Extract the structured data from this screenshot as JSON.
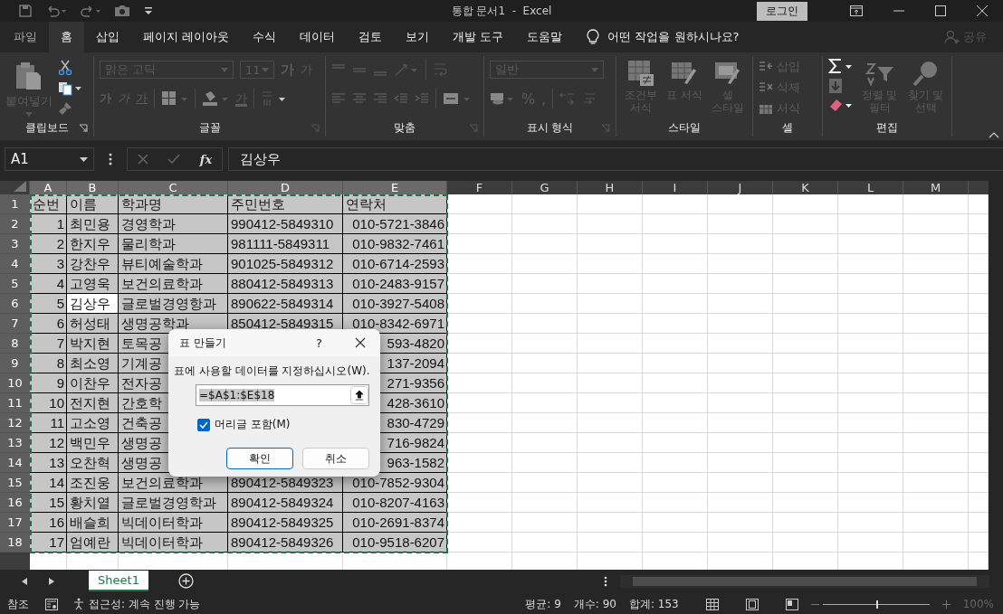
{
  "title_bar": {
    "title": "통합 문서1  -  Excel",
    "login": "로그인"
  },
  "tabs": [
    {
      "label": "파일",
      "selected": false
    },
    {
      "label": "홈",
      "selected": true
    },
    {
      "label": "삽입",
      "selected": false
    },
    {
      "label": "페이지 레이아웃",
      "selected": false
    },
    {
      "label": "수식",
      "selected": false
    },
    {
      "label": "데이터",
      "selected": false
    },
    {
      "label": "검토",
      "selected": false
    },
    {
      "label": "보기",
      "selected": false
    },
    {
      "label": "개발 도구",
      "selected": false
    },
    {
      "label": "도움말",
      "selected": false
    }
  ],
  "tell_me": "어떤 작업을 원하시나요?",
  "share": "공유",
  "ribbon": {
    "clipboard": {
      "paste": "붙여넣기",
      "label": "클립보드"
    },
    "font": {
      "name": "맑은 고딕",
      "size": "11",
      "grow": "가",
      "shrink": "가",
      "bold": "가",
      "italic": "가",
      "underline": "가",
      "font_color_label": "가",
      "label": "글꼴"
    },
    "alignment": {
      "label": "맞춤"
    },
    "number": {
      "format": "일반",
      "percent": "%",
      "comma": ",",
      "label": "표시 형식"
    },
    "styles": {
      "conditional": "조건부 서식",
      "table": "표 서식",
      "cell": "셀 스타일",
      "label": "스타일"
    },
    "cells": {
      "insert": "삽입",
      "delete": "삭제",
      "format": "서식",
      "label": "셀"
    },
    "editing": {
      "sort": "정렬 및 필터",
      "find": "찾기 및 선택",
      "label": "편집"
    }
  },
  "formula_bar": {
    "name_box": "A1",
    "fx": "fx",
    "value": "김상우"
  },
  "sheet": {
    "columns": [
      {
        "label": "A",
        "selected": true
      },
      {
        "label": "B",
        "selected": true
      },
      {
        "label": "C",
        "selected": true
      },
      {
        "label": "D",
        "selected": true
      },
      {
        "label": "E",
        "selected": true
      },
      {
        "label": "F",
        "selected": false
      },
      {
        "label": "G",
        "selected": false
      },
      {
        "label": "H",
        "selected": false
      },
      {
        "label": "I",
        "selected": false
      },
      {
        "label": "J",
        "selected": false
      },
      {
        "label": "K",
        "selected": false
      },
      {
        "label": "L",
        "selected": false
      },
      {
        "label": "M",
        "selected": false
      }
    ],
    "rows": [
      {
        "num": "1",
        "kind": "header",
        "selected": true,
        "name_cell_active": false,
        "cells": {
          "seq": "순번",
          "name": "이름",
          "dept": "학과명",
          "rrn": "주민번호",
          "phone": "연락처"
        }
      },
      {
        "num": "2",
        "kind": "record",
        "selected": true,
        "name_cell_active": false,
        "cells": {
          "seq": "1",
          "name": "최민용",
          "dept": "경영학과",
          "rrn": "990412-5849310",
          "phone": "010-5721-3846"
        }
      },
      {
        "num": "3",
        "kind": "record",
        "selected": true,
        "name_cell_active": false,
        "cells": {
          "seq": "2",
          "name": "한지우",
          "dept": "물리학과",
          "rrn": "981111-5849311",
          "phone": "010-9832-7461"
        }
      },
      {
        "num": "4",
        "kind": "record",
        "selected": true,
        "name_cell_active": false,
        "cells": {
          "seq": "3",
          "name": "강찬우",
          "dept": "뷰티예술학과",
          "rrn": "901025-5849312",
          "phone": "010-6714-2593"
        }
      },
      {
        "num": "5",
        "kind": "record",
        "selected": true,
        "name_cell_active": false,
        "cells": {
          "seq": "4",
          "name": "고영욱",
          "dept": "보건의료학과",
          "rrn": "880412-5849313",
          "phone": "010-2483-9157"
        }
      },
      {
        "num": "6",
        "kind": "record",
        "selected": true,
        "name_cell_active": true,
        "cells": {
          "seq": "5",
          "name": "김상우",
          "dept": "글로벌경영항과",
          "rrn": "890622-5849314",
          "phone": "010-3927-5408"
        }
      },
      {
        "num": "7",
        "kind": "record",
        "selected": true,
        "name_cell_active": false,
        "cells": {
          "seq": "6",
          "name": "허성태",
          "dept": "생명공학과",
          "rrn": "850412-5849315",
          "phone": "010-8342-6971"
        }
      },
      {
        "num": "8",
        "kind": "record",
        "selected": true,
        "name_cell_active": false,
        "cells": {
          "seq": "7",
          "name": "박지현",
          "dept": "토목공",
          "phone": "593-4820"
        }
      },
      {
        "num": "9",
        "kind": "record",
        "selected": true,
        "name_cell_active": false,
        "cells": {
          "seq": "8",
          "name": "최소영",
          "dept": "기계공",
          "phone": "137-2094"
        }
      },
      {
        "num": "10",
        "kind": "record",
        "selected": true,
        "name_cell_active": false,
        "cells": {
          "seq": "9",
          "name": "이찬우",
          "dept": "전자공",
          "phone": "271-9356"
        }
      },
      {
        "num": "11",
        "kind": "record",
        "selected": true,
        "name_cell_active": false,
        "cells": {
          "seq": "10",
          "name": "전지현",
          "dept": "간호학",
          "phone": "428-3610"
        }
      },
      {
        "num": "12",
        "kind": "record",
        "selected": true,
        "name_cell_active": false,
        "cells": {
          "seq": "11",
          "name": "고소영",
          "dept": "건축공",
          "phone": "830-4729"
        }
      },
      {
        "num": "13",
        "kind": "record",
        "selected": true,
        "name_cell_active": false,
        "cells": {
          "seq": "12",
          "name": "백민우",
          "dept": "생명공",
          "phone": "716-9824"
        }
      },
      {
        "num": "14",
        "kind": "record",
        "selected": true,
        "name_cell_active": false,
        "cells": {
          "seq": "13",
          "name": "오찬혁",
          "dept": "생명공",
          "phone": "963-1582"
        }
      },
      {
        "num": "15",
        "kind": "record",
        "selected": true,
        "name_cell_active": false,
        "cells": {
          "seq": "14",
          "name": "조진웅",
          "dept": "보건의료학과",
          "rrn": "890412-5849323",
          "phone": "010-7852-9304"
        }
      },
      {
        "num": "16",
        "kind": "record",
        "selected": true,
        "name_cell_active": false,
        "cells": {
          "seq": "15",
          "name": "황치열",
          "dept": "글로벌경영학과",
          "rrn": "890412-5849324",
          "phone": "010-8207-4163"
        }
      },
      {
        "num": "17",
        "kind": "record",
        "selected": true,
        "name_cell_active": false,
        "cells": {
          "seq": "16",
          "name": "배슬희",
          "dept": "빅데이터학과",
          "rrn": "890412-5849325",
          "phone": "010-2691-8374"
        }
      },
      {
        "num": "18",
        "kind": "record",
        "selected": true,
        "name_cell_active": false,
        "cells": {
          "seq": "17",
          "name": "엄예란",
          "dept": "빅데이터학과",
          "rrn": "890412-5849326",
          "phone": "010-9518-6207"
        }
      }
    ]
  },
  "dialog": {
    "title": "표 만들기",
    "help": "?",
    "prompt": "표에 사용할 데이터를 지정하십시오(W).",
    "range": "=$A$1:$E$18",
    "header_checkbox": {
      "label": "머리글 포함(M)",
      "checked": true
    },
    "ok": "확인",
    "cancel": "취소"
  },
  "sheet_tabs": [
    {
      "label": "Sheet1",
      "selected": true
    }
  ],
  "status_bar": {
    "mode": "참조",
    "accessibility": "접근성: 계속 진행 가능",
    "average": "평균: 9",
    "count": "개수: 90",
    "sum": "합계: 153",
    "zoom": {
      "level": 0.5,
      "reading": "100%"
    }
  }
}
